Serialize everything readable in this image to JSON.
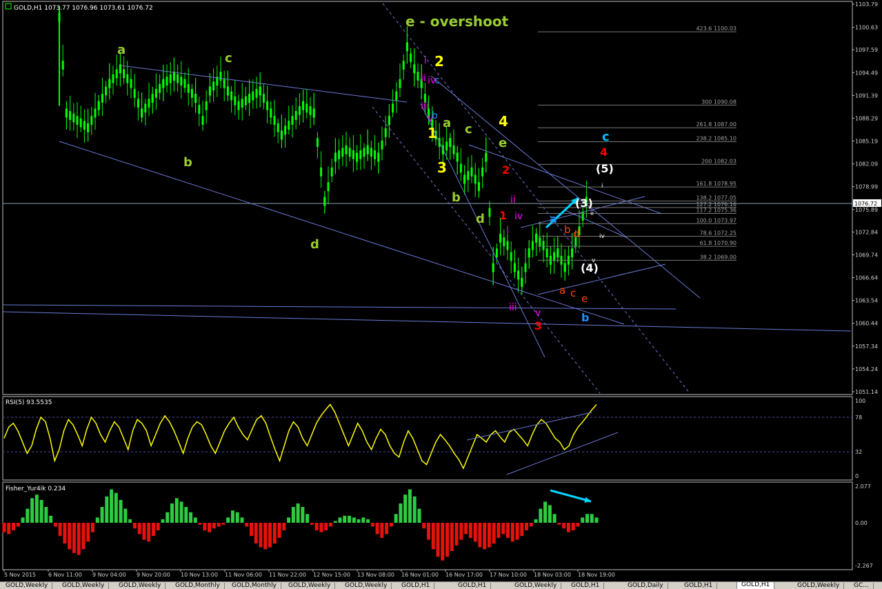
{
  "chart_data": [
    {
      "type": "candlestick",
      "title": "GOLD,H1  1073.77 1076.96 1073.61 1076.72",
      "symbol": "GOLD,H1",
      "ohlc": {
        "open": 1073.77,
        "high": 1076.96,
        "low": 1073.61,
        "close": 1076.72
      },
      "current_price": "1076.72",
      "ylim": [
        1051.14,
        1103.79
      ],
      "y_ticks": [
        "1103.79",
        "1100.63",
        "1097.59",
        "1094.49",
        "1091.39",
        "1088.29",
        "1085.19",
        "1082.09",
        "1078.99",
        "1075.89",
        "1072.84",
        "1069.74",
        "1066.64",
        "1063.54",
        "1060.44",
        "1057.34",
        "1054.24",
        "1051.14"
      ],
      "x_ticks": [
        "5 Nov 2015",
        "6 Nov 11:00",
        "9 Nov 04:00",
        "9 Nov 20:00",
        "10 Nov 13:00",
        "11 Nov 06:00",
        "11 Nov 22:00",
        "12 Nov 15:00",
        "13 Nov 08:00",
        "16 Nov 01:00",
        "16 Nov 17:00",
        "17 Nov 10:00",
        "18 Nov 03:00",
        "18 Nov 19:00"
      ],
      "price_path": [
        [
          0,
          1102
        ],
        [
          2,
          1089
        ],
        [
          5,
          1088
        ],
        [
          8,
          1087
        ],
        [
          11,
          1090
        ],
        [
          14,
          1093
        ],
        [
          17,
          1095
        ],
        [
          20,
          1093
        ],
        [
          23,
          1089
        ],
        [
          26,
          1091
        ],
        [
          29,
          1093
        ],
        [
          32,
          1094
        ],
        [
          35,
          1093
        ],
        [
          38,
          1091
        ],
        [
          40,
          1088
        ],
        [
          42,
          1092
        ],
        [
          45,
          1094
        ],
        [
          47,
          1092
        ],
        [
          50,
          1090
        ],
        [
          53,
          1091
        ],
        [
          56,
          1092
        ],
        [
          59,
          1089
        ],
        [
          62,
          1086
        ],
        [
          65,
          1088
        ],
        [
          68,
          1090
        ],
        [
          71,
          1089
        ],
        [
          74,
          1077
        ],
        [
          77,
          1083
        ],
        [
          80,
          1084
        ],
        [
          83,
          1083
        ],
        [
          86,
          1084
        ],
        [
          89,
          1083
        ],
        [
          92,
          1088
        ],
        [
          95,
          1093
        ],
        [
          97,
          1098
        ],
        [
          99,
          1095
        ],
        [
          101,
          1093
        ],
        [
          103,
          1089
        ],
        [
          105,
          1086
        ],
        [
          107,
          1084
        ],
        [
          109,
          1085
        ],
        [
          111,
          1083
        ],
        [
          113,
          1080
        ],
        [
          115,
          1081
        ],
        [
          117,
          1079
        ],
        [
          119,
          1083
        ],
        [
          121,
          1068
        ],
        [
          123,
          1072
        ],
        [
          125,
          1071
        ],
        [
          127,
          1068
        ],
        [
          129,
          1066
        ],
        [
          131,
          1070
        ],
        [
          133,
          1072
        ],
        [
          135,
          1071
        ],
        [
          137,
          1069
        ],
        [
          139,
          1070
        ],
        [
          141,
          1068
        ],
        [
          143,
          1070
        ],
        [
          145,
          1073
        ],
        [
          147,
          1077
        ]
      ],
      "wave_labels": [
        {
          "text": "a",
          "color": "#9acd32"
        },
        {
          "text": "c",
          "color": "#9acd32"
        },
        {
          "text": "b",
          "color": "#9acd32"
        },
        {
          "text": "d",
          "color": "#9acd32"
        },
        {
          "text": "e - overshoot",
          "color": "#9acd32"
        },
        {
          "text": "2",
          "color": "#ffff00"
        },
        {
          "text": "1",
          "color": "#ffff00"
        },
        {
          "text": "3",
          "color": "#ffff00"
        },
        {
          "text": "4",
          "color": "#ffff00"
        },
        {
          "text": "a",
          "color": "#9acd32"
        },
        {
          "text": "c",
          "color": "#9acd32"
        },
        {
          "text": "e",
          "color": "#9acd32"
        },
        {
          "text": "b",
          "color": "#9acd32"
        },
        {
          "text": "d",
          "color": "#9acd32"
        },
        {
          "text": "i",
          "color": "#ff00ff"
        },
        {
          "text": "ii",
          "color": "#ff00ff"
        },
        {
          "text": "iii",
          "color": "#ff00ff"
        },
        {
          "text": "iv",
          "color": "#ff00ff"
        },
        {
          "text": "v",
          "color": "#ff00ff"
        },
        {
          "text": "c",
          "color": "#1e90ff"
        },
        {
          "text": "b",
          "color": "#1e90ff"
        },
        {
          "text": "1",
          "color": "#ff0000"
        },
        {
          "text": "2",
          "color": "#ff0000"
        },
        {
          "text": "3",
          "color": "#ff0000"
        },
        {
          "text": "4",
          "color": "#ff0000"
        },
        {
          "text": "ii",
          "color": "#ff00ff"
        },
        {
          "text": "iv",
          "color": "#ff00ff"
        },
        {
          "text": "i",
          "color": "#ff00ff"
        },
        {
          "text": "iii",
          "color": "#ff00ff"
        },
        {
          "text": "v",
          "color": "#ff00ff"
        },
        {
          "text": "a",
          "color": "#1e90ff"
        },
        {
          "text": "b",
          "color": "#1e90ff"
        },
        {
          "text": "c",
          "color": "#00bfff"
        },
        {
          "text": "b",
          "color": "#ff4500"
        },
        {
          "text": "d",
          "color": "#ff4500"
        },
        {
          "text": "a",
          "color": "#ff4500"
        },
        {
          "text": "c",
          "color": "#ff4500"
        },
        {
          "text": "e",
          "color": "#ff4500"
        },
        {
          "text": "(3)",
          "color": "#ffffff"
        },
        {
          "text": "(4)",
          "color": "#ffffff"
        },
        {
          "text": "(5)",
          "color": "#ffffff"
        },
        {
          "text": "i",
          "color": "#ffffff"
        },
        {
          "text": "ii",
          "color": "#ffffff"
        },
        {
          "text": "iv",
          "color": "#ffffff"
        },
        {
          "text": "v",
          "color": "#ffffff"
        }
      ],
      "fib_levels": [
        {
          "label": "423.6  1100.03",
          "value": 1100.03
        },
        {
          "label": "300  1090.08",
          "value": 1090.08
        },
        {
          "label": "261.8  1087.00",
          "value": 1087.0
        },
        {
          "label": "238.2  1085.10",
          "value": 1085.1
        },
        {
          "label": "200  1082.03",
          "value": 1082.03
        },
        {
          "label": "161.8  1078.95",
          "value": 1078.95
        },
        {
          "label": "138.2  1077.05",
          "value": 1077.05
        },
        {
          "label": "127.2  1076.16",
          "value": 1076.16
        },
        {
          "label": "117.2  1075.36",
          "value": 1075.36
        },
        {
          "label": "100.0  1073.97",
          "value": 1073.97
        },
        {
          "label": "78.6  1072.25",
          "value": 1072.25
        },
        {
          "label": "61.8  1070.90",
          "value": 1070.9
        },
        {
          "label": "38.2  1069.00",
          "value": 1069.0
        }
      ]
    },
    {
      "type": "line",
      "title": "RSI(5) 93.5535",
      "ylim": [
        0,
        100
      ],
      "y_ticks": [
        "100",
        "78",
        "32",
        "0"
      ],
      "levels": [
        78,
        32
      ],
      "color": "#ffff00",
      "values": [
        50,
        65,
        70,
        60,
        45,
        30,
        40,
        62,
        78,
        72,
        50,
        20,
        35,
        60,
        75,
        68,
        55,
        40,
        62,
        78,
        70,
        55,
        45,
        60,
        72,
        65,
        50,
        35,
        60,
        75,
        70,
        60,
        40,
        55,
        70,
        80,
        72,
        60,
        45,
        30,
        50,
        65,
        72,
        68,
        55,
        40,
        30,
        45,
        60,
        70,
        78,
        65,
        55,
        48,
        62,
        75,
        80,
        70,
        52,
        35,
        20,
        40,
        60,
        72,
        65,
        50,
        40,
        55,
        70,
        80,
        88,
        95,
        85,
        70,
        55,
        40,
        55,
        70,
        60,
        45,
        35,
        50,
        62,
        55,
        40,
        30,
        25,
        45,
        60,
        50,
        35,
        20,
        15,
        30,
        45,
        55,
        48,
        40,
        30,
        22,
        10,
        25,
        40,
        55,
        50,
        45,
        55,
        60,
        52,
        45,
        58,
        62,
        55,
        48,
        40,
        55,
        68,
        75,
        70,
        60,
        50,
        45,
        35,
        40,
        55,
        65,
        72,
        80,
        88,
        95
      ]
    },
    {
      "type": "bar",
      "title": "Fisher_Yur4ik 0.234",
      "ylim": [
        -2.267,
        2.077
      ],
      "y_ticks": [
        "2.077",
        "0.00",
        "-2.267"
      ],
      "positive_color": "#2ecc40",
      "negative_color": "#e8120c",
      "values": [
        -0.5,
        -0.6,
        -0.4,
        -0.2,
        0.3,
        0.8,
        1.4,
        1.6,
        1.3,
        0.9,
        0.4,
        -0.2,
        -0.7,
        -1.1,
        -1.4,
        -1.6,
        -1.7,
        -1.4,
        -1.0,
        -0.5,
        0.3,
        0.9,
        1.5,
        1.9,
        1.7,
        1.3,
        0.8,
        0.2,
        -0.3,
        -0.6,
        -0.9,
        -1.0,
        -0.7,
        -0.4,
        0.2,
        0.6,
        1.1,
        1.4,
        1.2,
        0.9,
        0.6,
        0.3,
        -0.1,
        -0.4,
        -0.5,
        -0.3,
        -0.2,
        -0.1,
        0.3,
        0.7,
        0.6,
        0.3,
        -0.2,
        -0.7,
        -1.1,
        -1.3,
        -1.4,
        -1.3,
        -1.1,
        -0.8,
        -0.4,
        0.3,
        0.9,
        1.1,
        0.9,
        0.5,
        -0.1,
        -0.4,
        -0.5,
        -0.4,
        -0.2,
        0.1,
        0.3,
        0.4,
        0.4,
        0.3,
        0.2,
        0.3,
        0.2,
        -0.2,
        -0.6,
        -0.8,
        -0.6,
        -0.2,
        0.5,
        1.1,
        1.6,
        1.9,
        1.5,
        0.8,
        -0.3,
        -0.9,
        -1.4,
        -1.8,
        -2.0,
        -1.8,
        -1.5,
        -1.2,
        -0.9,
        -0.6,
        -0.8,
        -1.0,
        -1.3,
        -1.4,
        -1.3,
        -1.1,
        -0.8,
        -0.6,
        -0.8,
        -1.0,
        -0.9,
        -0.7,
        -0.4,
        -0.2,
        0.2,
        0.8,
        1.2,
        1.0,
        0.5,
        -0.1,
        -0.3,
        -0.5,
        -0.4,
        -0.2,
        0.3,
        0.5,
        0.5,
        0.3
      ]
    }
  ],
  "tabs": [
    "GOLD,Weekly",
    "GOLD,Weekly",
    "GOLD,Weekly",
    "GOLD,Monthly",
    "GOLD,Monthly",
    "GOLD,Weekly",
    "GOLD,Weekly",
    "GOLD,H1",
    "GOLD,H1",
    "GOLD,Weekly",
    "GOLD,H1",
    "GOLD,Daily",
    "GOLD,H1",
    "GOLD,H1",
    "GOLD,Weekly",
    "GC..."
  ],
  "active_tab_index": 13,
  "colors": {
    "background": "#000000",
    "grid": "#1a1a1a",
    "frame": "#c0c0c0",
    "candle": "#00ff00",
    "trend": "#6a7bd6",
    "arrow": "#00d5ff"
  }
}
